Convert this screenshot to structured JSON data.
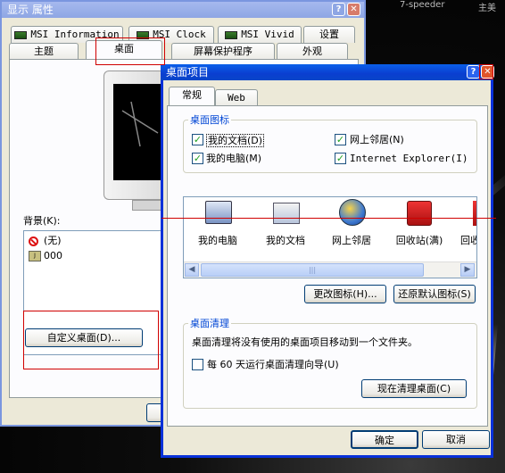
{
  "desktop": {
    "top_text_1": "7-speeder",
    "top_text_2": "主美"
  },
  "back_window": {
    "title": "显示 属性",
    "tabs_row1": [
      "MSI Information",
      "MSI Clock",
      "MSI Vivid",
      "设置"
    ],
    "tabs_row2": [
      "主题",
      "桌面",
      "屏幕保护程序",
      "外观"
    ],
    "background_label": "背景(K):",
    "background_items": [
      "(无)",
      "000"
    ],
    "customize_button": "自定义桌面(D)..."
  },
  "front_window": {
    "title": "桌面项目",
    "tabs": [
      "常规",
      "Web"
    ],
    "desktop_icons_group": "桌面图标",
    "checkboxes": [
      {
        "label": "我的文档(D)",
        "checked": true
      },
      {
        "label": "网上邻居(N)",
        "checked": true
      },
      {
        "label": "我的电脑(M)",
        "checked": true
      },
      {
        "label": "Internet Explorer(I)",
        "checked": true
      }
    ],
    "icons": [
      "我的电脑",
      "我的文档",
      "网上邻居",
      "回收站(满)",
      "回收"
    ],
    "change_icon_button": "更改图标(H)...",
    "restore_default_button": "还原默认图标(S)",
    "cleanup_group": "桌面清理",
    "cleanup_desc": "桌面清理将没有使用的桌面项目移动到一个文件夹。",
    "cleanup_every_label": "每 60 天运行桌面清理向导(U)",
    "cleanup_now_button": "现在清理桌面(C)",
    "ok_button": "确定",
    "cancel_button": "取消"
  },
  "colors": {
    "accent": "#0a3ed0",
    "annotation": "#d00000"
  }
}
